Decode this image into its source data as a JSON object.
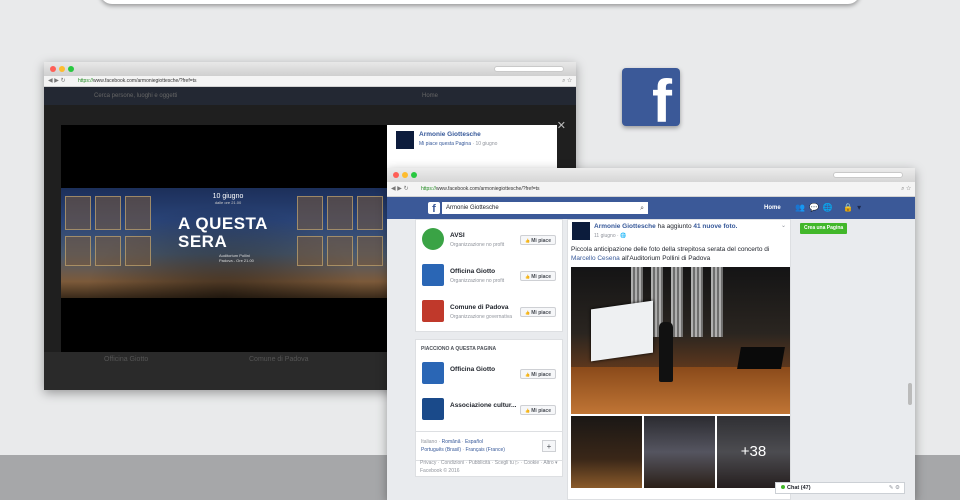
{
  "colors": {
    "fb_blue": "#3b5998",
    "link": "#365899",
    "green": "#42b72a"
  },
  "browser_back": {
    "url_secure": "https://",
    "url_rest": "www.facebook.com/armoniegiottesche/?fref=ts",
    "dimmed_nav": {
      "left": "Cerca persone, luoghi e oggetti",
      "home": "Home"
    },
    "poster": {
      "date": "10 giugno",
      "time": "dalle ore 21.00",
      "title_line1": "A QUESTA",
      "title_line2": "SERA",
      "venue_line1": "Auditorium Pollini",
      "venue_line2": "Padova - Ore 21.00"
    },
    "side_card": {
      "name": "Armonie Giottesche",
      "like_label": "Mi piace questa Pagina",
      "date": "10 giugno"
    },
    "dimmed_below": {
      "left": "Officina Giotto",
      "right": "Comune di Padova"
    },
    "close_icon": "close-icon"
  },
  "browser_front": {
    "url_secure": "https://",
    "url_rest": "www.facebook.com/armoniegiottesche/?fref=ts",
    "nav": {
      "search_value": "Armonie Giottesche",
      "home": "Home",
      "create_page": "Crea una Pagina"
    },
    "recommended": [
      {
        "name": "AVSI",
        "category": "Organizzazione no profit",
        "like": "Mi piace",
        "logo_color": "#3aa345"
      },
      {
        "name": "Officina Giotto",
        "category": "Organizzazione no profit",
        "like": "Mi piace",
        "logo_color": "#2a66b5"
      },
      {
        "name": "Comune di Padova",
        "category": "Organizzazione governativa",
        "like": "Mi piace",
        "logo_color": "#c0392b"
      }
    ],
    "liked_section": {
      "header": "PIACCIONO A QUESTA PAGINA",
      "items": [
        {
          "name": "Officina Giotto",
          "like": "Mi piace"
        },
        {
          "name": "Associazione cultur...",
          "like": "Mi piace"
        }
      ]
    },
    "languages": {
      "current": "Italiano",
      "links": [
        "Română",
        "Español",
        "Português (Brasil)",
        "Français (France)"
      ],
      "plus": "+"
    },
    "footer": "Privacy · Condizioni · Pubblicità · Scegli tu ▷ · Cookie · Altro ▾",
    "copyright": "Facebook © 2016",
    "post": {
      "author": "Armonie Giottesche",
      "action": "ha aggiunto",
      "photos_link": "41 nuove foto.",
      "date": "11 giugno",
      "text_pre": "Piccola anticipazione delle foto della strepitosa serata del concerto di",
      "person_link": "Marcello Cesena",
      "text_post": "all'Auditorium Pollini di Padova",
      "more_count": "+38"
    },
    "chat": "Chat (47)"
  }
}
